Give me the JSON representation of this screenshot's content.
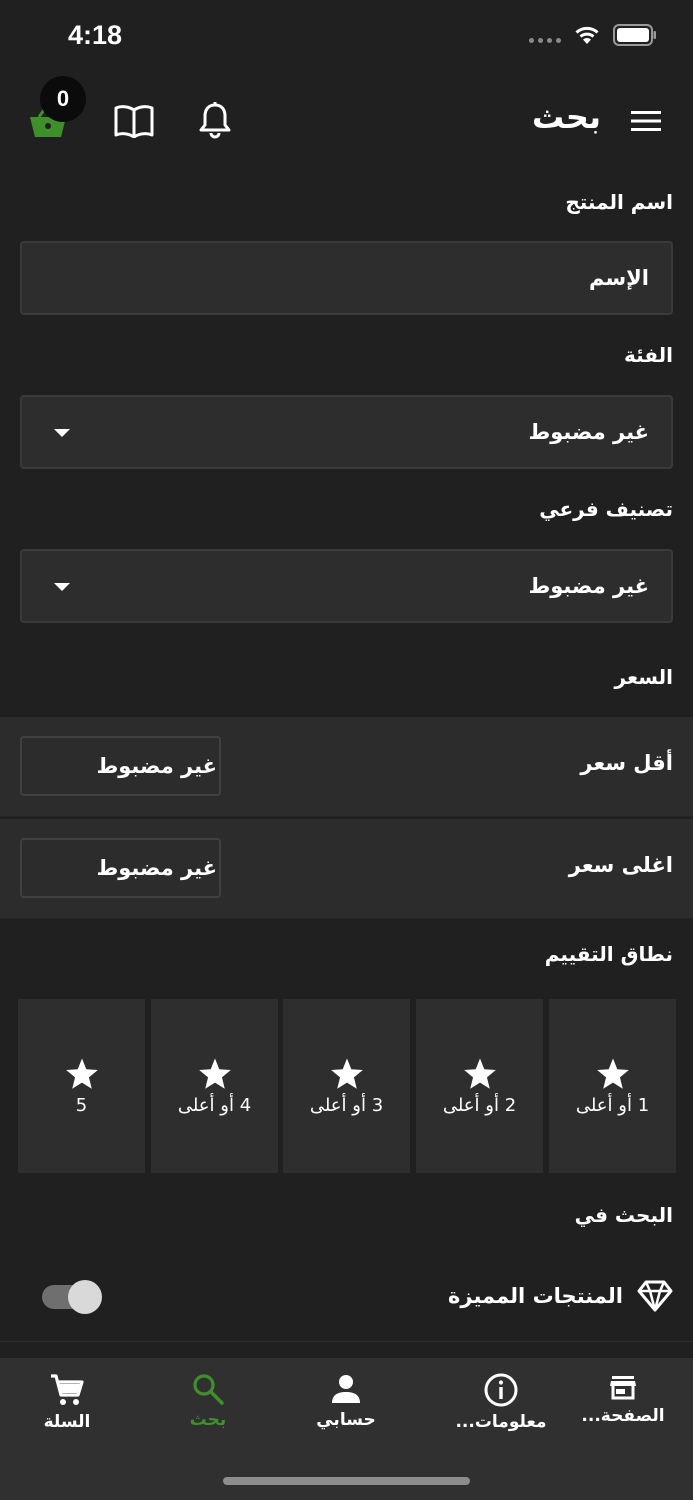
{
  "status_bar": {
    "time": "4:18"
  },
  "header": {
    "title": "بحث",
    "cart_count": "0"
  },
  "form": {
    "product_name_label": "اسم المنتج",
    "product_name_placeholder": "الإسم",
    "category_label": "الفئة",
    "category_value": "غير مضبوط",
    "subcategory_label": "تصنيف فرعي",
    "subcategory_value": "غير مضبوط",
    "price_label": "السعر",
    "min_price_label": "أقل سعر",
    "min_price_value": "غير مضبوط",
    "max_price_label": "اغلى سعر",
    "max_price_value": "غير مضبوط",
    "rating_label": "نطاق التقييم",
    "ratings": [
      {
        "text": "1 أو أعلى"
      },
      {
        "text": "2 أو أعلى"
      },
      {
        "text": "3 أو أعلى"
      },
      {
        "text": "4 أو أعلى"
      },
      {
        "text": "5"
      }
    ],
    "search_in_label": "البحث في",
    "featured_label": "المنتجات المميزة",
    "featured_enabled": false
  },
  "bottom_nav": {
    "items": [
      {
        "label": "الصفحة...",
        "icon": "store-icon"
      },
      {
        "label": "معلومات...",
        "icon": "info-icon"
      },
      {
        "label": "حسابي",
        "icon": "person-icon"
      },
      {
        "label": "بحث",
        "icon": "search-icon",
        "active": true
      },
      {
        "label": "السلة",
        "icon": "cart-icon"
      }
    ]
  },
  "colors": {
    "background": "#202020",
    "accent": "#3f8f2b",
    "panel": "#2c2c2c"
  }
}
